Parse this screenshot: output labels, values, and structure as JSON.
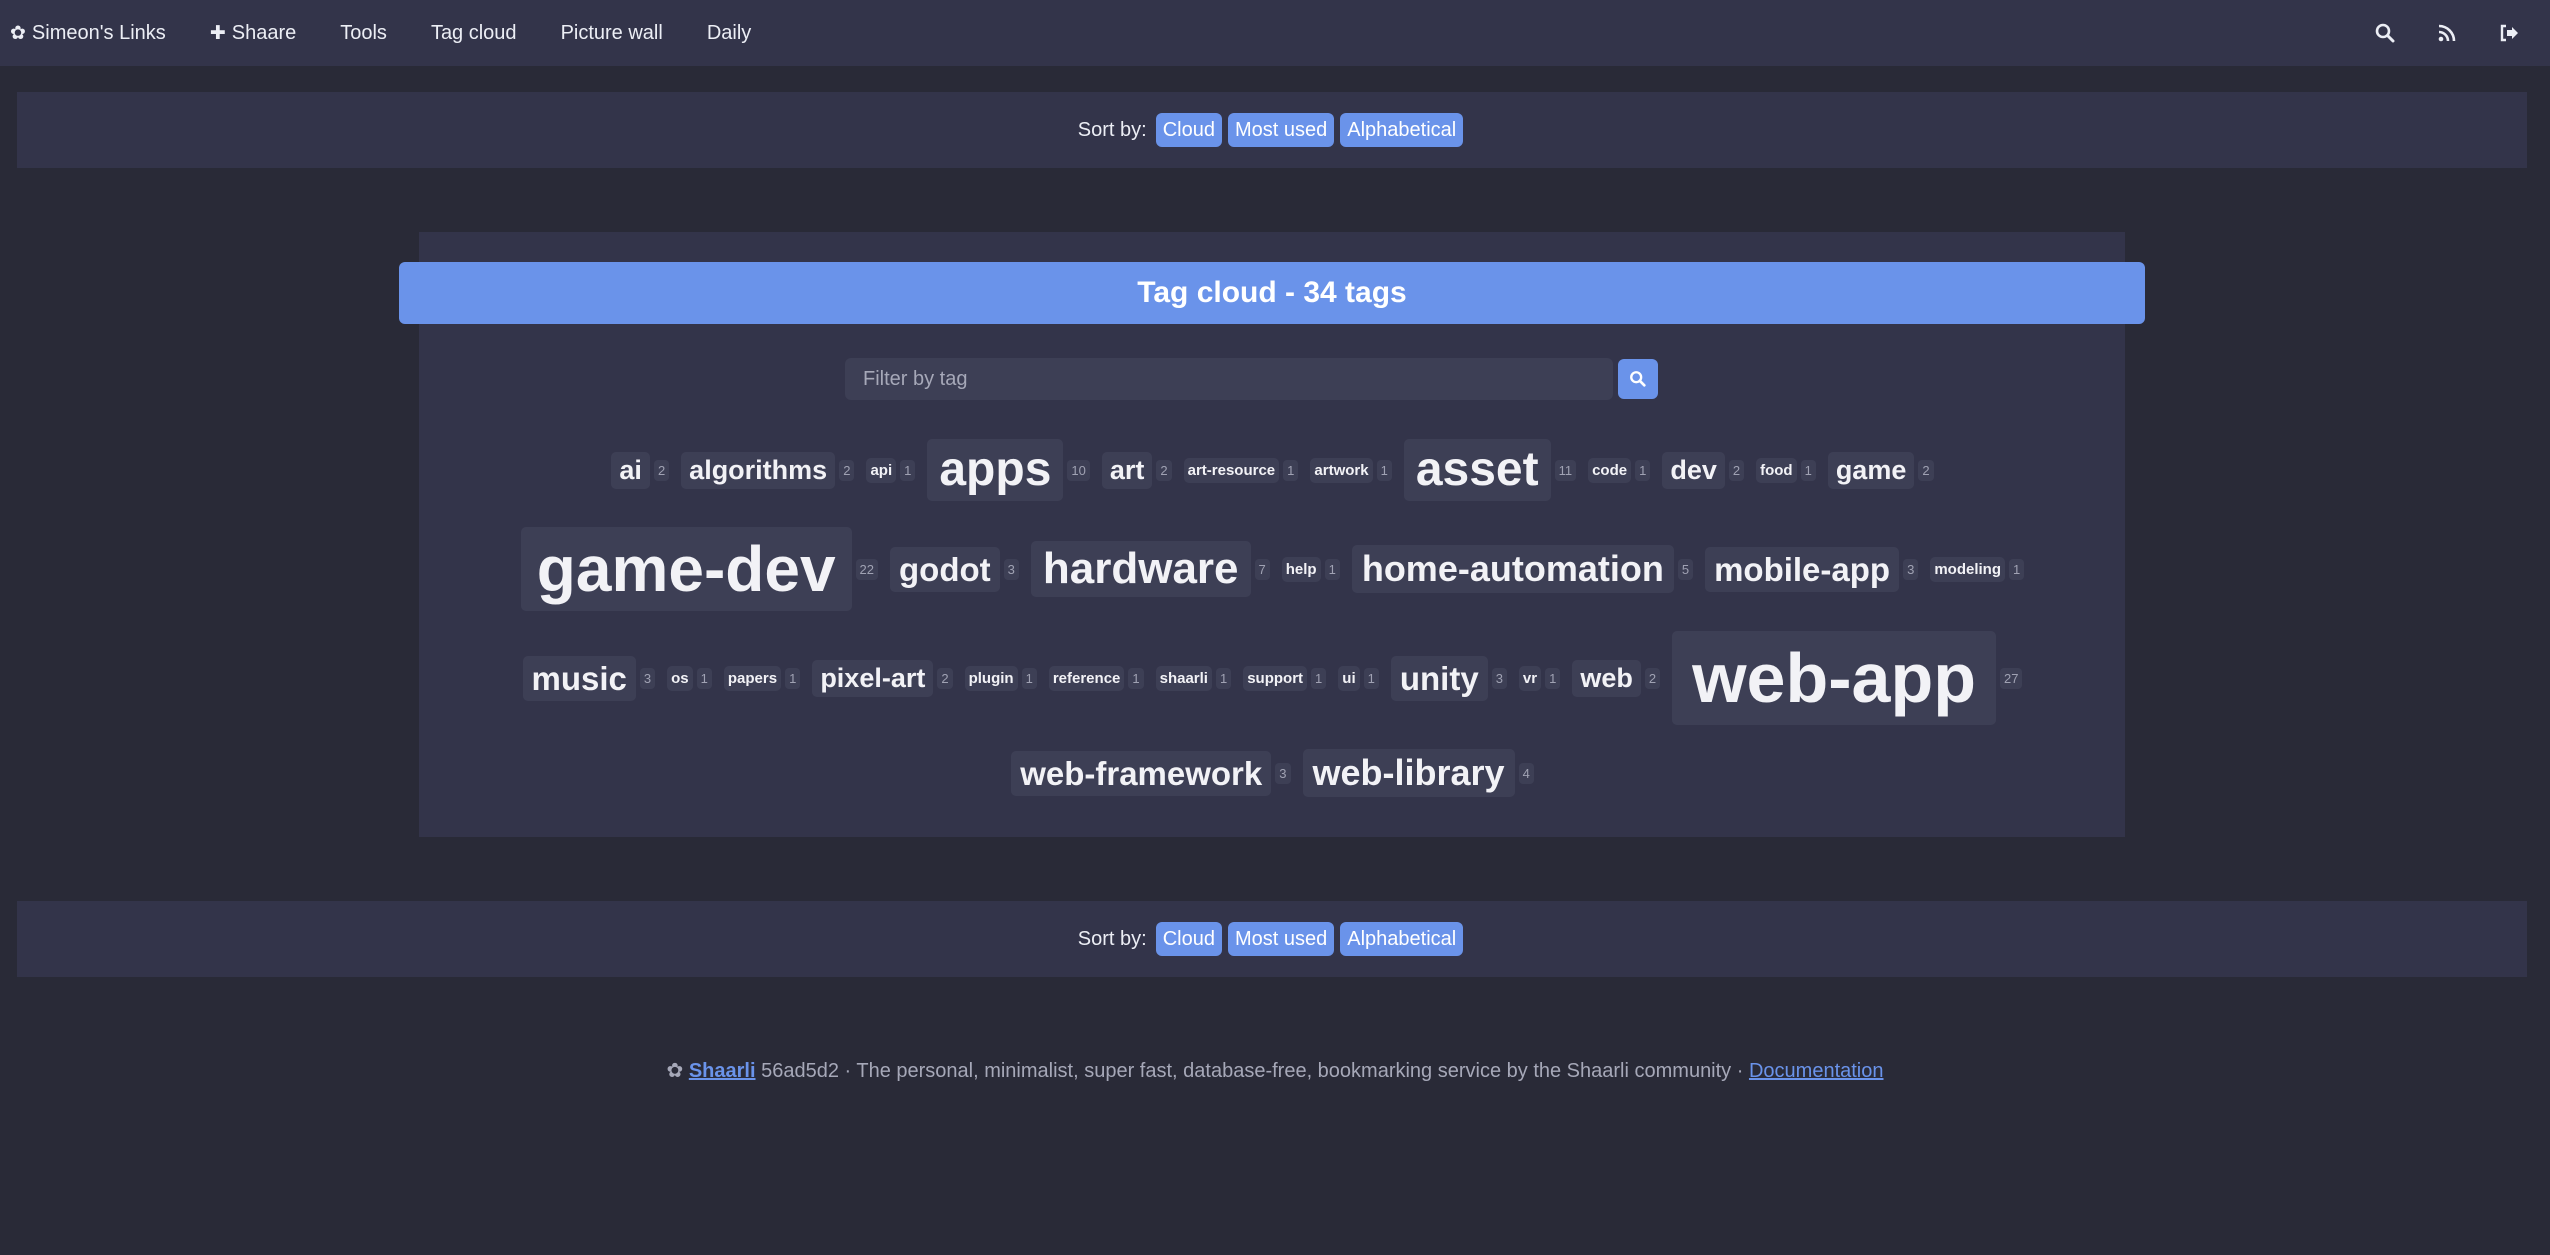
{
  "nav": {
    "brand": "Simeon's Links",
    "brand_icon": "✿",
    "shaare": "Shaare",
    "shaare_icon": "✚",
    "tools": "Tools",
    "tag_cloud": "Tag cloud",
    "picture_wall": "Picture wall",
    "daily": "Daily",
    "right_icons": [
      "search-icon",
      "rss-icon",
      "logout-icon"
    ]
  },
  "sort": {
    "label": "Sort by:",
    "options": [
      "Cloud",
      "Most used",
      "Alphabetical"
    ]
  },
  "title": "Tag cloud - 34 tags",
  "filter": {
    "placeholder": "Filter by tag"
  },
  "tags": [
    {
      "name": "ai",
      "count": "2"
    },
    {
      "name": "algorithms",
      "count": "2"
    },
    {
      "name": "api",
      "count": "1"
    },
    {
      "name": "apps",
      "count": "10"
    },
    {
      "name": "art",
      "count": "2"
    },
    {
      "name": "art-resource",
      "count": "1"
    },
    {
      "name": "artwork",
      "count": "1"
    },
    {
      "name": "asset",
      "count": "11"
    },
    {
      "name": "code",
      "count": "1"
    },
    {
      "name": "dev",
      "count": "2"
    },
    {
      "name": "food",
      "count": "1"
    },
    {
      "name": "game",
      "count": "2"
    },
    {
      "name": "game-dev",
      "count": "22"
    },
    {
      "name": "godot",
      "count": "3"
    },
    {
      "name": "hardware",
      "count": "7"
    },
    {
      "name": "help",
      "count": "1"
    },
    {
      "name": "home-automation",
      "count": "5"
    },
    {
      "name": "mobile-app",
      "count": "3"
    },
    {
      "name": "modeling",
      "count": "1"
    },
    {
      "name": "music",
      "count": "3"
    },
    {
      "name": "os",
      "count": "1"
    },
    {
      "name": "papers",
      "count": "1"
    },
    {
      "name": "pixel-art",
      "count": "2"
    },
    {
      "name": "plugin",
      "count": "1"
    },
    {
      "name": "reference",
      "count": "1"
    },
    {
      "name": "shaarli",
      "count": "1"
    },
    {
      "name": "support",
      "count": "1"
    },
    {
      "name": "ui",
      "count": "1"
    },
    {
      "name": "unity",
      "count": "3"
    },
    {
      "name": "vr",
      "count": "1"
    },
    {
      "name": "web",
      "count": "2"
    },
    {
      "name": "web-app",
      "count": "27"
    },
    {
      "name": "web-framework",
      "count": "3"
    },
    {
      "name": "web-library",
      "count": "4"
    }
  ],
  "footer": {
    "icon": "✿",
    "brand": "Shaarli",
    "text": "56ad5d2 · The personal, minimalist, super fast, database-free, bookmarking service by the Shaarli community ·",
    "doc_link": "Documentation"
  },
  "colors": {
    "background": "#292a37",
    "panel": "#33344a",
    "accent": "#6a93ea",
    "tag_bg": "#3d3f55"
  }
}
